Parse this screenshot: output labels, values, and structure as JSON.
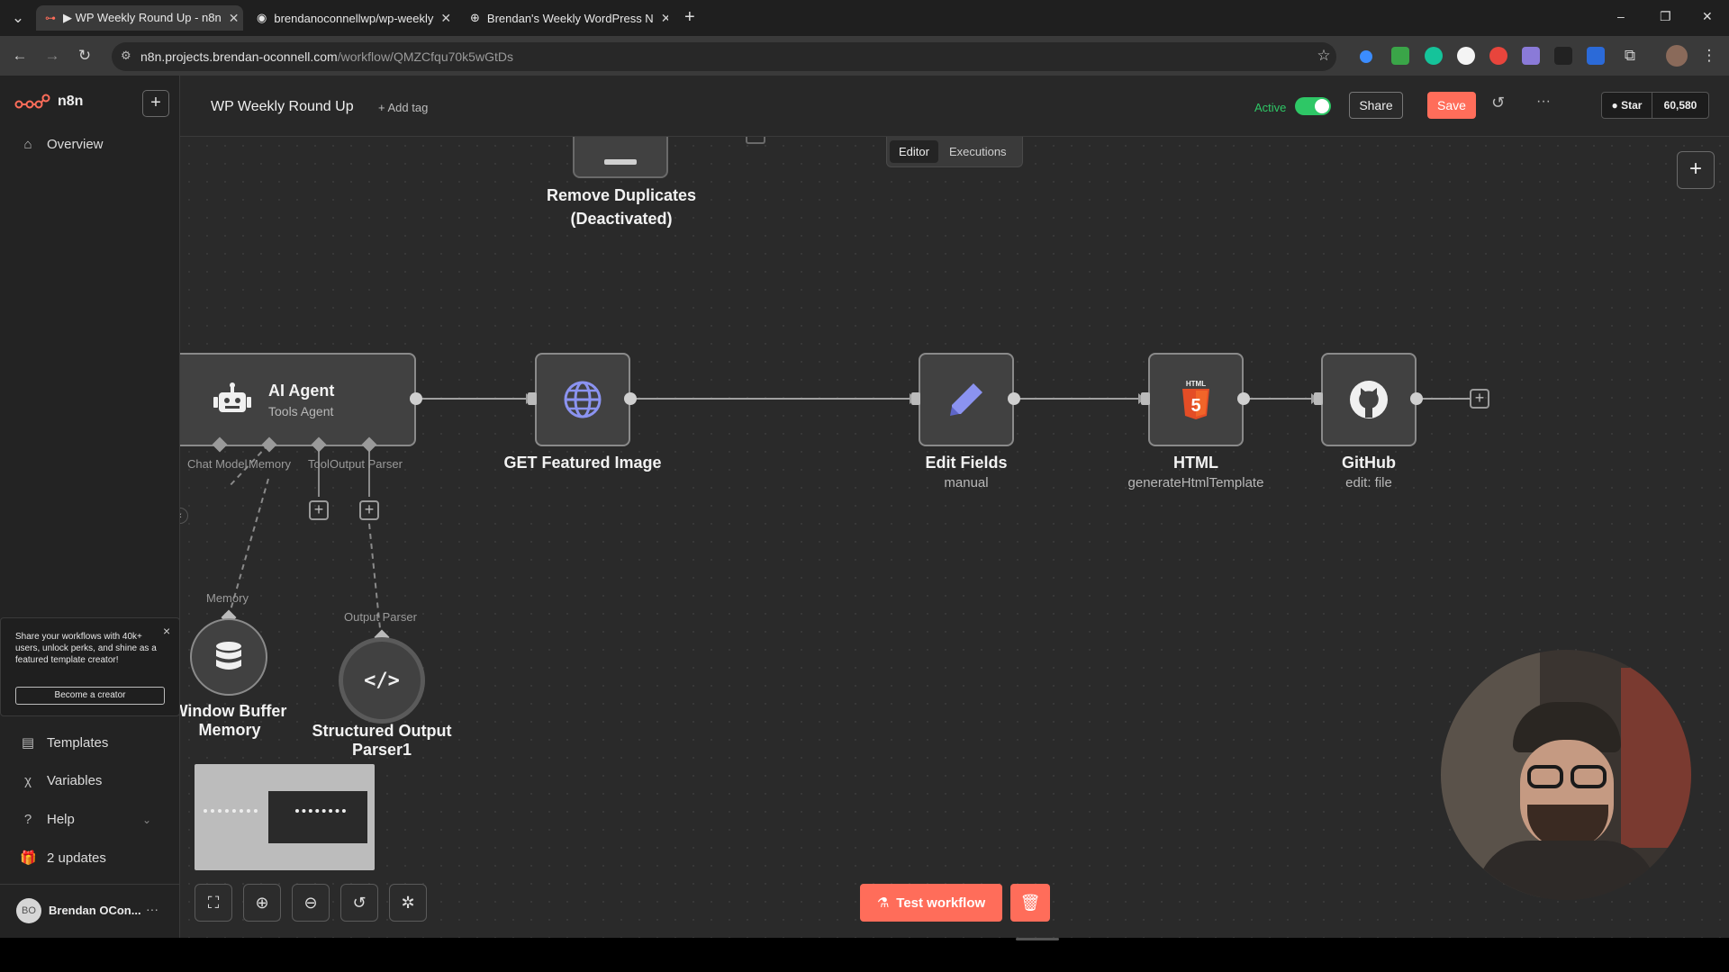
{
  "browser": {
    "tabs": [
      {
        "title": "▶ WP Weekly Round Up - n8n",
        "active": true
      },
      {
        "title": "brendanoconnellwp/wp-weekly",
        "active": false
      },
      {
        "title": "Brendan's Weekly WordPress N",
        "active": false
      }
    ],
    "new_tab": "+",
    "url_domain": "n8n.projects.brendan-oconnell.com",
    "url_path": "/workflow/QMZCfqu70k5wGtDs",
    "window_controls": {
      "minimize": "–",
      "restore": "❐",
      "close": "✕"
    }
  },
  "sidebar": {
    "brand": "n8n",
    "add_label": "+",
    "overview": "Overview",
    "promo": {
      "text": "Share your workflows with 40k+ users, unlock perks, and shine as a featured template creator!",
      "close": "×",
      "button": "Become a creator"
    },
    "items": [
      {
        "label": "Templates",
        "icon": "templates-icon"
      },
      {
        "label": "Variables",
        "icon": "variables-icon"
      },
      {
        "label": "Help",
        "icon": "help-icon"
      },
      {
        "label": "2 updates",
        "icon": "gift-icon"
      }
    ],
    "user": {
      "initials": "BO",
      "name": "Brendan OCon...",
      "menu": "···"
    }
  },
  "header": {
    "workflow_name": "WP Weekly Round Up",
    "add_tag": "+ Add tag",
    "active_label": "Active",
    "share": "Share",
    "save": "Save",
    "star": "Star",
    "star_count": "60,580",
    "tabs": [
      {
        "label": "Editor",
        "active": true
      },
      {
        "label": "Executions",
        "active": false
      }
    ]
  },
  "nodes": {
    "remove_duplicates": {
      "title_line1": "Remove Duplicates",
      "title_line2": "(Deactivated)"
    },
    "ai_agent": {
      "title": "AI Agent",
      "subtitle": "Tools Agent"
    },
    "ai_ports": {
      "chat_model": "Chat Model",
      "memory": "Memory",
      "tool": "Tool",
      "output_parser": "Output Parser"
    },
    "get_featured_image": {
      "title": "GET Featured Image"
    },
    "edit_fields": {
      "title": "Edit Fields",
      "subtitle": "manual"
    },
    "html": {
      "title": "HTML",
      "subtitle": "generateHtmlTemplate",
      "badge": "HTML"
    },
    "github": {
      "title": "GitHub",
      "subtitle": "edit: file"
    },
    "memory": {
      "port_label": "Memory",
      "title_line1": "Window Buffer",
      "title_line2": "Memory"
    },
    "output_parser": {
      "port_label": "Output Parser",
      "title_line1": "Structured Output",
      "title_line2": "Parser1"
    }
  },
  "footer": {
    "test_workflow": "Test workflow"
  },
  "colors": {
    "accent": "#ff6d5a",
    "active_green": "#2ec766",
    "node_border": "#8a8a8a",
    "canvas_bg": "#2a2a2a"
  }
}
